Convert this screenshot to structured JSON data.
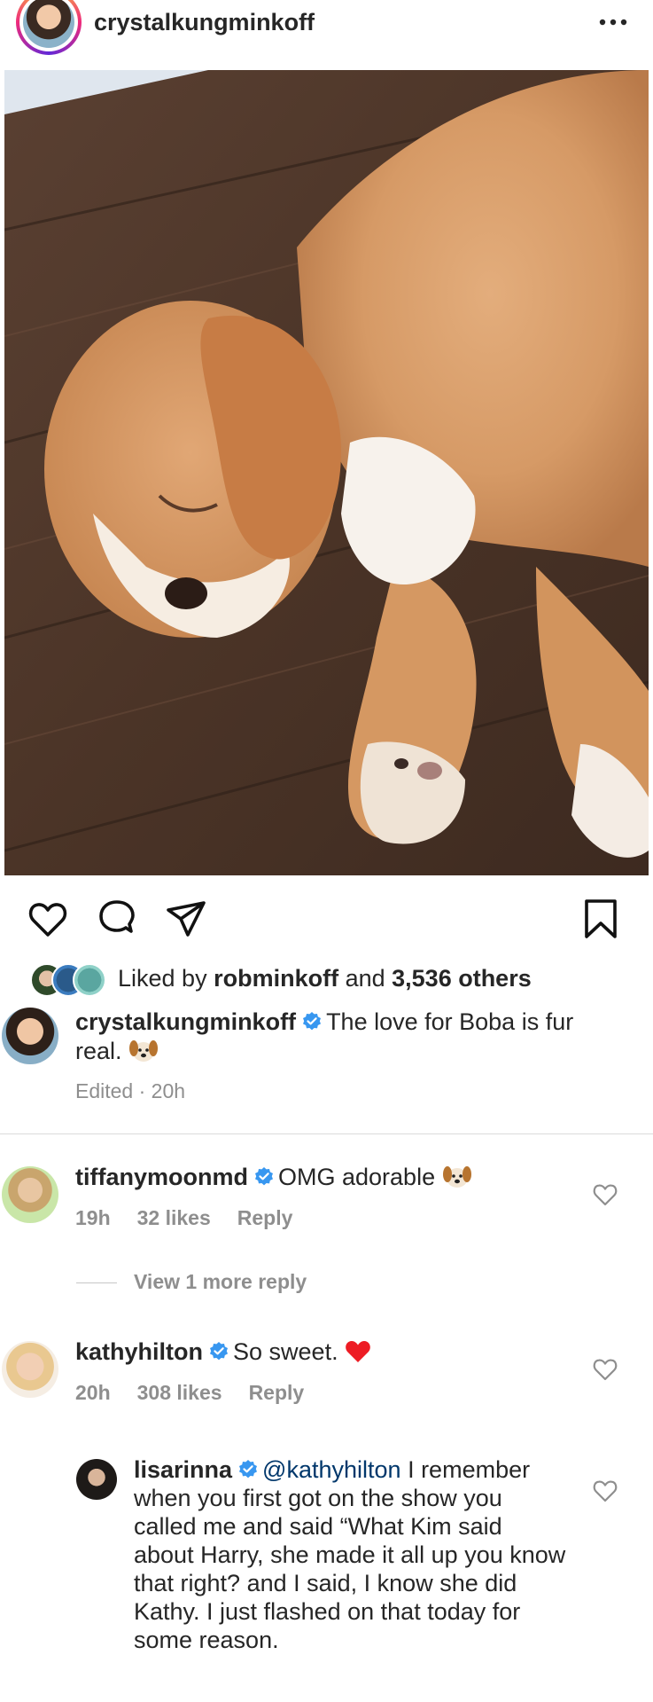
{
  "header": {
    "username": "crystalkungminkoff",
    "more_icon": "more-horizontal-icon"
  },
  "post": {
    "image_alt": "sleeping puppy",
    "actions": {
      "like_icon": "heart-icon",
      "comment_icon": "comment-icon",
      "share_icon": "send-icon",
      "save_icon": "bookmark-icon"
    },
    "likes": {
      "prefix": "Liked by ",
      "user": "robminkoff",
      "middle": " and ",
      "others": "3,536 others"
    },
    "caption": {
      "username": "crystalkungminkoff",
      "text": "The love for Boba is fur real.",
      "meta": "Edited · 20h"
    }
  },
  "comments": [
    {
      "username": "tiffanymoonmd",
      "text": "OMG adorable",
      "time": "19h",
      "likes": "32 likes",
      "reply": "Reply",
      "view_more": "View 1 more reply"
    },
    {
      "username": "kathyhilton",
      "text": "So sweet.",
      "emoji": "❤️",
      "time": "20h",
      "likes": "308 likes",
      "reply": "Reply"
    },
    {
      "username": "lisarinna",
      "mention": "@kathyhilton",
      "text": "I remember when you first got on the show you called me and said “What Kim said about Harry, she made it all up you know that right? and I said, I know she did Kathy. I just flashed on that today for some reason."
    }
  ],
  "colors": {
    "verified": "#3897f0",
    "meta_gray": "#8e8e8e",
    "mention_blue": "#00376b",
    "heart_red": "#ed1c24"
  }
}
